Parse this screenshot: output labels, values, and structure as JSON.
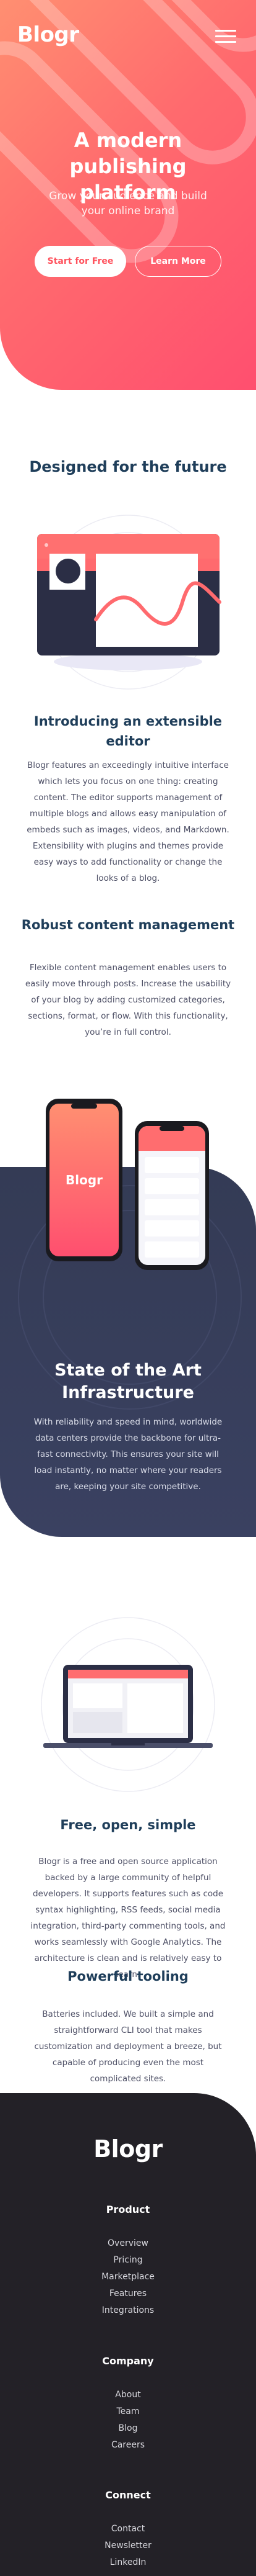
{
  "header": {
    "logo": "Blogr",
    "menu_icon": "hamburger-menu-icon"
  },
  "hero": {
    "title": "A modern publishing platform",
    "subtitle": "Grow your audience and build your online brand",
    "primary_button": "Start for Free",
    "secondary_button": "Learn More"
  },
  "section_future": {
    "heading": "Designed for the future",
    "editor": {
      "title": "Introducing an extensible editor",
      "text": "Blogr features an exceedingly intuitive interface which lets you focus on one thing: creating content. The editor supports management of multiple blogs and allows easy manipulation of embeds such as images, videos, and Markdown. Extensibility with plugins and themes provide easy ways to add functionality or change the looks of a blog."
    },
    "content_management": {
      "title": "Robust content management",
      "text": "Flexible content management enables users to easily move through posts. Increase the usability of your blog by adding customized categories, sections, format, or flow. With this functionality, you’re in full control."
    }
  },
  "section_infrastructure": {
    "phone_logo": "Blogr",
    "title": "State of the Art Infrastructure",
    "text": "With reliability and speed in mind, worldwide data centers provide the backbone for ultra-fast connectivity. This ensures your site will load instantly, no matter where your readers are, keeping your site competitive."
  },
  "section_features": {
    "open_simple": {
      "title": "Free, open, simple",
      "text": "Blogr is a free and open source application backed by a large community of helpful developers. It supports features such as code syntax highlighting, RSS feeds, social media integration, third-party commenting tools, and works seamlessly with Google Analytics. The architecture is clean and is relatively easy to learn."
    },
    "tooling": {
      "title": "Powerful tooling",
      "text": "Batteries included. We built a simple and straightforward CLI tool that makes customization and deployment a breeze, but capable of producing even the most complicated sites."
    }
  },
  "footer": {
    "logo": "Blogr",
    "columns": [
      {
        "heading": "Product",
        "links": [
          "Overview",
          "Pricing",
          "Marketplace",
          "Features",
          "Integrations"
        ]
      },
      {
        "heading": "Company",
        "links": [
          "About",
          "Team",
          "Blog",
          "Careers"
        ]
      },
      {
        "heading": "Connect",
        "links": [
          "Contact",
          "Newsletter",
          "LinkedIn"
        ]
      }
    ]
  },
  "colors": {
    "hero_start": "#ff8f71",
    "hero_end": "#ff4f6f",
    "heading": "#1f3e5a",
    "dark_band": "#343b55",
    "footer": "#232127"
  }
}
